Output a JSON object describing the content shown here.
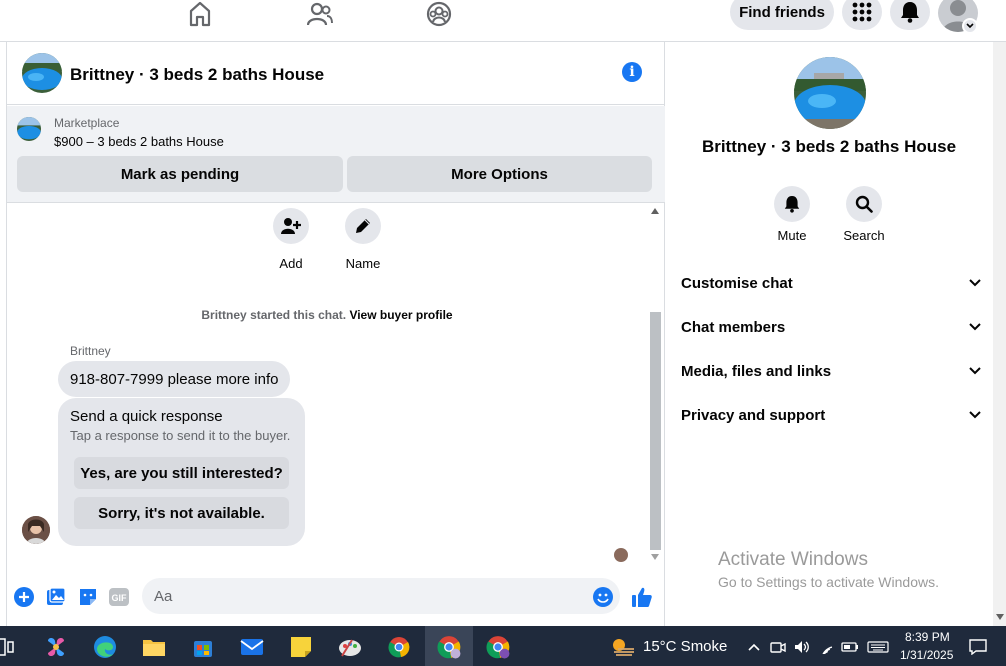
{
  "topbar": {
    "find_friends": "Find friends",
    "nav_icons": [
      "home-icon",
      "friends-icon",
      "groups-icon"
    ],
    "right_icons": [
      "apps-grid-icon",
      "bell-icon",
      "profile-avatar"
    ]
  },
  "chat": {
    "title": "Brittney · 3 beds 2 baths House",
    "marketplace": {
      "label": "Marketplace",
      "listing": "$900 – 3 beds 2 baths House",
      "mark_pending": "Mark as pending",
      "more_options": "More Options"
    },
    "actions": [
      {
        "label": "Add",
        "icon": "add-person-icon"
      },
      {
        "label": "Name",
        "icon": "pencil-icon"
      }
    ],
    "started_text": "Brittney started this chat.",
    "view_buyer_profile": "View buyer profile",
    "sender_name": "Brittney",
    "message": "918-807-7999 please more info",
    "quick_response": {
      "title": "Send a quick response",
      "subtitle": "Tap a response to send it to the buyer.",
      "options": [
        "Yes, are you still interested?",
        "Sorry, it's not available."
      ]
    },
    "composer": {
      "placeholder": "Aa",
      "icons": [
        "plus-circle-icon",
        "image-icon",
        "sticker-icon",
        "gif-icon",
        "emoji-icon",
        "thumbs-up-icon"
      ]
    }
  },
  "side": {
    "title": "Brittney · 3 beds 2 baths House",
    "actions": [
      {
        "label": "Mute",
        "icon": "bell-icon"
      },
      {
        "label": "Search",
        "icon": "search-icon"
      }
    ],
    "sections": [
      "Customise chat",
      "Chat members",
      "Media, files and links",
      "Privacy and support"
    ]
  },
  "watermark": {
    "line1": "Activate Windows",
    "line2": "Go to Settings to activate Windows."
  },
  "taskbar": {
    "weather": "15°C  Smoke",
    "time": "8:39 PM",
    "date": "1/31/2025"
  },
  "colors": {
    "accent": "#1877f2",
    "taskbar": "#1f2a3c",
    "bubble": "#e4e6eb"
  }
}
